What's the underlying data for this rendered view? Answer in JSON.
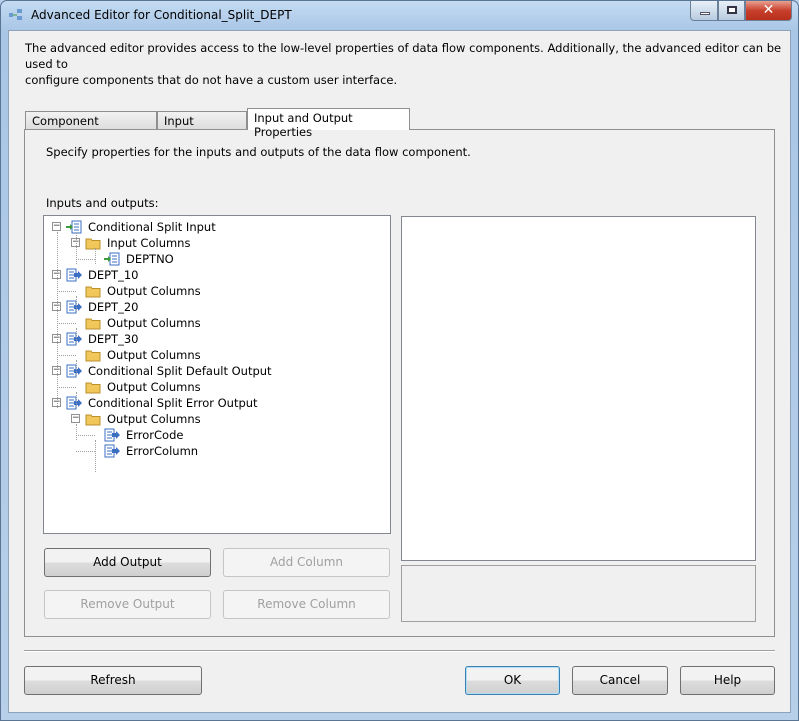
{
  "window": {
    "title": "Advanced Editor for Conditional_Split_DEPT"
  },
  "description": [
    "The advanced editor provides access to the low-level properties of data flow components. Additionally, the advanced editor can be used to",
    "configure components that do not have a custom user interface."
  ],
  "tabs": [
    {
      "label": "Component Properties"
    },
    {
      "label": "Input Columns"
    },
    {
      "label": "Input and Output Properties",
      "active": true
    }
  ],
  "panel": {
    "instruction": "Specify properties for the inputs and outputs of the data flow component.",
    "tree_label": "Inputs and outputs:"
  },
  "tree": [
    {
      "label": "Conditional Split Input",
      "level": 0,
      "icon": "input-icon",
      "expanded": true
    },
    {
      "label": "Input Columns",
      "level": 1,
      "icon": "folder-icon",
      "expanded": true
    },
    {
      "label": "DEPTNO",
      "level": 2,
      "icon": "input-column-icon"
    },
    {
      "label": "DEPT_10",
      "level": 0,
      "icon": "output-icon",
      "expanded": true
    },
    {
      "label": "Output Columns",
      "level": 1,
      "icon": "folder-icon"
    },
    {
      "label": "DEPT_20",
      "level": 0,
      "icon": "output-icon",
      "expanded": true
    },
    {
      "label": "Output Columns",
      "level": 1,
      "icon": "folder-icon"
    },
    {
      "label": "DEPT_30",
      "level": 0,
      "icon": "output-icon",
      "expanded": true
    },
    {
      "label": "Output Columns",
      "level": 1,
      "icon": "folder-icon"
    },
    {
      "label": "Conditional Split Default Output",
      "level": 0,
      "icon": "output-icon",
      "expanded": true
    },
    {
      "label": "Output Columns",
      "level": 1,
      "icon": "folder-icon"
    },
    {
      "label": "Conditional Split Error Output",
      "level": 0,
      "icon": "output-icon",
      "expanded": true
    },
    {
      "label": "Output Columns",
      "level": 1,
      "icon": "folder-icon",
      "expanded": true
    },
    {
      "label": "ErrorCode",
      "level": 2,
      "icon": "output-column-icon"
    },
    {
      "label": "ErrorColumn",
      "level": 2,
      "icon": "output-column-icon"
    }
  ],
  "buttons": {
    "add_output": "Add Output",
    "add_column": "Add Column",
    "remove_output": "Remove Output",
    "remove_column": "Remove Column",
    "refresh": "Refresh",
    "ok": "OK",
    "cancel": "Cancel",
    "help": "Help"
  },
  "colors": {
    "close_button": "#c8402c",
    "folder": "#f2c75a",
    "icon_blue": "#3a6fc4",
    "arrow_green": "#3d9a3d"
  }
}
